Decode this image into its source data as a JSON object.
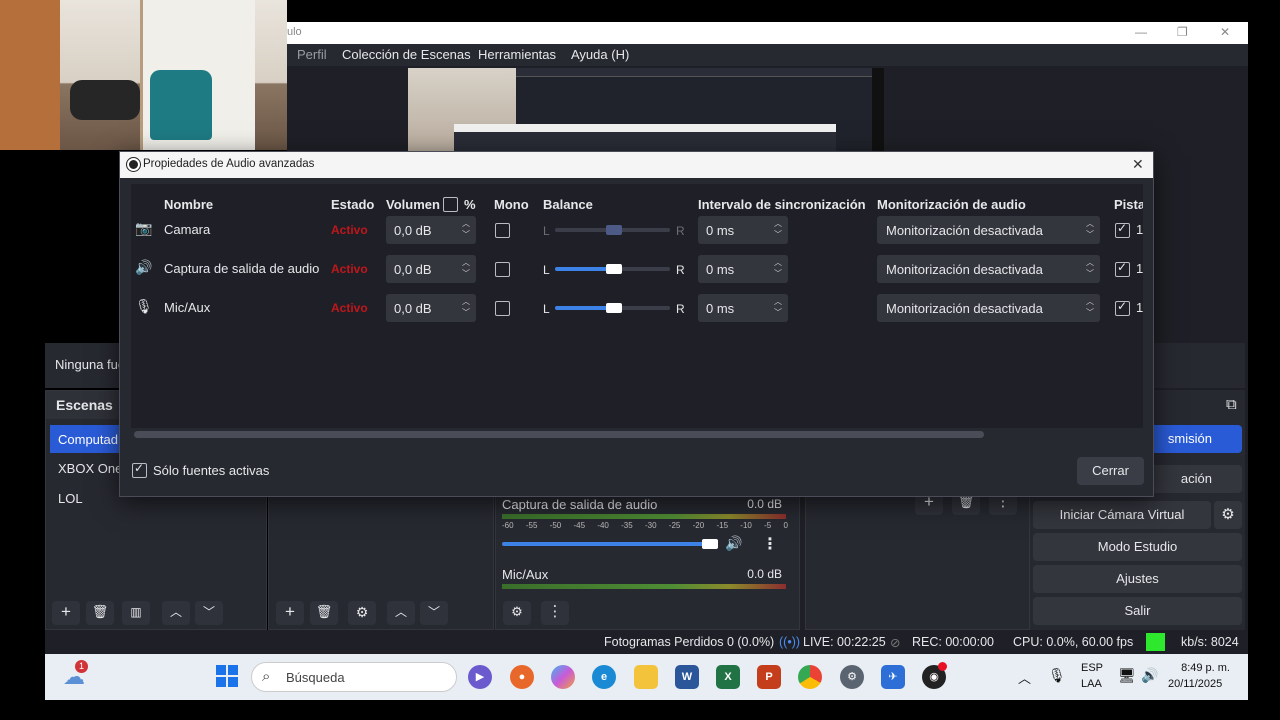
{
  "window": {
    "title_partial": "ulo"
  },
  "menu": [
    "Perfil",
    "Colección de Escenas",
    "Herramientas",
    "Ayuda (H)"
  ],
  "sources_bar": {
    "text": "Ninguna fue"
  },
  "scenes": {
    "title": "Escenas",
    "items": [
      "Computad",
      "XBOX One S",
      "LOL"
    ]
  },
  "mixer": {
    "tracks": [
      {
        "name": "Captura de salida de audio",
        "db": "0.0 dB",
        "volume_fraction": 0.95
      },
      {
        "name": "Mic/Aux",
        "db": "0.0 dB"
      }
    ],
    "scale": [
      "-60",
      "-55",
      "-50",
      "-45",
      "-40",
      "-35",
      "-30",
      "-25",
      "-20",
      "-15",
      "-10",
      "-5",
      "0"
    ]
  },
  "controls": {
    "items": [
      "smisión",
      "ación",
      "Iniciar Cámara Virtual",
      "Modo Estudio",
      "Ajustes",
      "Salir"
    ]
  },
  "statusbar": {
    "dropped": "Fotogramas Perdidos 0 (0.0%)",
    "live": "LIVE: 00:22:25",
    "rec": "REC: 00:00:00",
    "cpu": "CPU: 0.0%, 60.00 fps",
    "kbs": "kb/s: 8024"
  },
  "dialog": {
    "title": "Propiedades de Audio avanzadas",
    "headers": {
      "name": "Nombre",
      "state": "Estado",
      "volume": "Volumen",
      "percent": "%",
      "mono": "Mono",
      "balance": "Balance",
      "sync": "Intervalo de sincronización",
      "monitor": "Monitorización de audio",
      "tracks": "Pista"
    },
    "rows": [
      {
        "icon": "camera-icon",
        "name": "Camara",
        "state": "Activo",
        "volume": "0,0 dB",
        "mono": false,
        "balance_L": "L",
        "balance_R": "R",
        "balance_value": 0.5,
        "balance_enabled": false,
        "sync": "0 ms",
        "monitor": "Monitorización desactivada",
        "track1": "1",
        "track1_checked": true
      },
      {
        "icon": "speaker-icon",
        "name": "Captura de salida de audio",
        "state": "Activo",
        "volume": "0,0 dB",
        "mono": false,
        "balance_L": "L",
        "balance_R": "R",
        "balance_value": 0.5,
        "balance_enabled": true,
        "sync": "0 ms",
        "monitor": "Monitorización desactivada",
        "track1": "1",
        "track1_checked": true
      },
      {
        "icon": "microphone-icon",
        "name": "Mic/Aux",
        "state": "Activo",
        "volume": "0,0 dB",
        "mono": false,
        "balance_L": "L",
        "balance_R": "R",
        "balance_value": 0.5,
        "balance_enabled": true,
        "sync": "0 ms",
        "monitor": "Monitorización desactivada",
        "track1": "1",
        "track1_checked": true
      }
    ],
    "only_active_label": "Sólo fuentes activas",
    "only_active_checked": true,
    "close_label": "Cerrar"
  },
  "taskbar": {
    "search_placeholder": "Búsqueda",
    "weather_badge": "1",
    "lang1": "ESP",
    "lang2": "LAA",
    "time": "8:49 p. m.",
    "date": "20/11/2025"
  }
}
